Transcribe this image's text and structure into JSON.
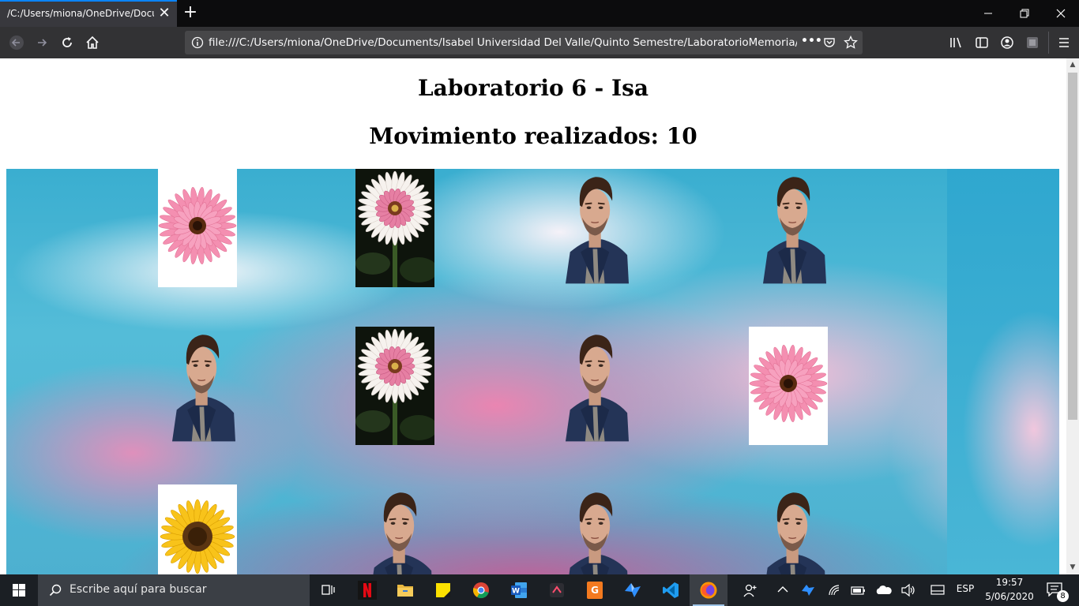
{
  "browser": {
    "tab_title": "/C:/Users/miona/OneDrive/Documents/Isabel Universidad Del Valle/Quinto Semestre/LaboratorioMemoria/Laboratorio",
    "url": "file:///C:/Users/miona/OneDrive/Documents/Isabel Universidad Del Valle/Quinto Semestre/LaboratorioMemoria/Laboratorio",
    "url_overflow_label": "•••"
  },
  "page": {
    "title": "Laboratorio 6 - Isa",
    "moves_text": "Movimiento realizados: 10"
  },
  "board": {
    "rows": [
      [
        "pink-gerbera",
        "white-gerbera",
        "portrait",
        "portrait"
      ],
      [
        "portrait",
        "white-gerbera",
        "portrait",
        "pink-gerbera"
      ],
      [
        "sunflower",
        "portrait",
        "portrait",
        "portrait"
      ]
    ]
  },
  "taskbar": {
    "search_placeholder": "Escribe aquí para buscar",
    "language": "ESP",
    "time": "19:57",
    "date": "5/06/2020",
    "notification_count": "8",
    "apps": [
      "task-view",
      "netflix",
      "file-explorer",
      "sticky-notes",
      "chrome",
      "word",
      "app-dark",
      "app-orange",
      "app-bluebird",
      "vscode",
      "firefox"
    ]
  },
  "colors": {
    "tab_accent": "#0a84ff",
    "toolbar": "#323234",
    "taskbar": "#1b1f24"
  }
}
